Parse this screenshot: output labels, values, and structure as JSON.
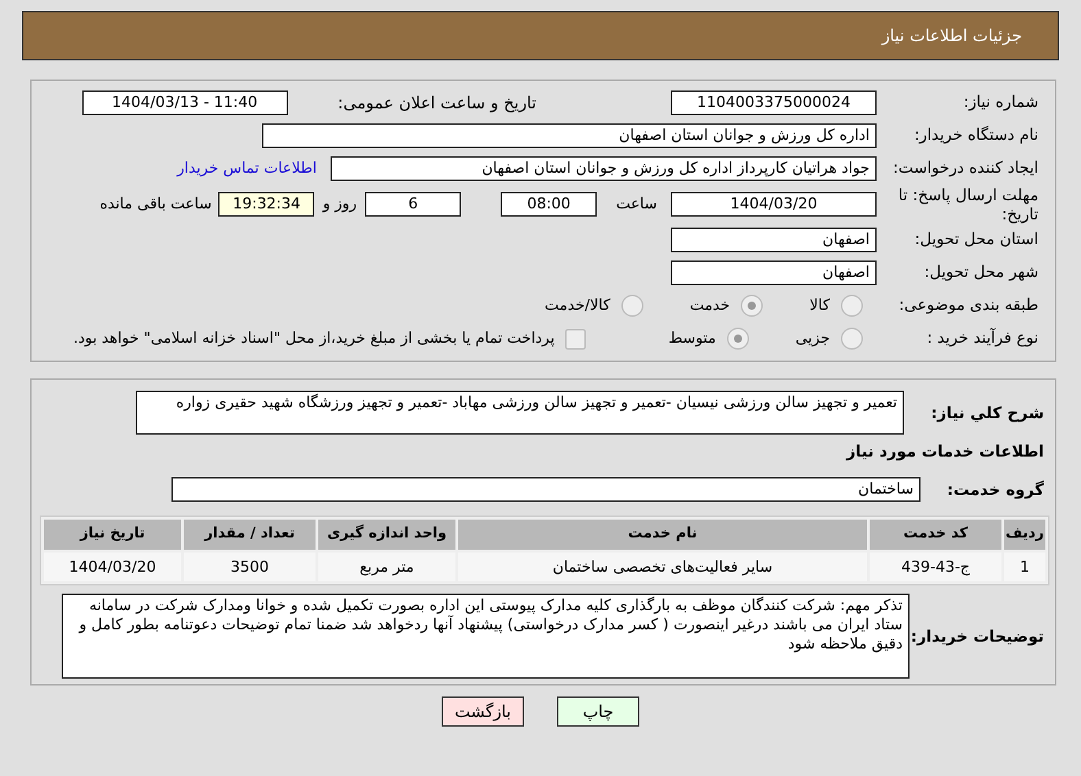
{
  "header": {
    "title": "جزئیات اطلاعات نیاز"
  },
  "details": {
    "need_number": {
      "label": "شماره نیاز:",
      "value": "1104003375000024"
    },
    "announce_datetime": {
      "label": "تاریخ و ساعت اعلان عمومی:",
      "value": "1404/03/13 - 11:40"
    },
    "buyer_org": {
      "label": "نام دستگاه خریدار:",
      "value": "اداره کل ورزش و جوانان استان اصفهان"
    },
    "requester": {
      "label": "ایجاد کننده درخواست:",
      "value": "جواد هراتیان کارپرداز اداره کل ورزش و جوانان استان اصفهان",
      "link": "اطلاعات تماس خریدار"
    },
    "deadline": {
      "label": "مهلت ارسال پاسخ: تا تاریخ:",
      "date": "1404/03/20",
      "time_label": "ساعت",
      "time": "08:00",
      "days": "6",
      "days_label": "روز و",
      "remaining": "19:32:34",
      "remaining_label": "ساعت باقی مانده"
    },
    "province": {
      "label": "استان محل تحویل:",
      "value": "اصفهان"
    },
    "city": {
      "label": "شهر محل تحویل:",
      "value": "اصفهان"
    },
    "category": {
      "label": "طبقه بندی موضوعی:",
      "options": [
        {
          "label": "کالا",
          "selected": false
        },
        {
          "label": "خدمت",
          "selected": true
        },
        {
          "label": "کالا/خدمت",
          "selected": false
        }
      ]
    },
    "process": {
      "label": "نوع فرآیند خرید :",
      "options": [
        {
          "label": "جزیی",
          "selected": false
        },
        {
          "label": "متوسط",
          "selected": true
        }
      ],
      "payment": {
        "label": "پرداخت تمام یا بخشی از مبلغ خرید،از محل \"اسناد خزانه اسلامی\" خواهد بود.",
        "checked": false
      }
    }
  },
  "summary": {
    "label": "شرح کلي نياز:",
    "value": "تعمیر و تجهیز سالن ورزشی نیسیان -تعمیر و تجهیز سالن ورزشی مهاباد -تعمیر و تجهیز ورزشگاه شهید حقیری زواره"
  },
  "services": {
    "title": "اطلاعات خدمات مورد نیاز",
    "group_label": "گروه خدمت:",
    "group": "ساختمان",
    "table": {
      "columns": [
        "ردیف",
        "کد خدمت",
        "نام خدمت",
        "واحد اندازه گیری",
        "تعداد / مقدار",
        "تاریخ نیاز"
      ],
      "rows": [
        [
          "1",
          "ج-43-439",
          "سایر فعالیت‌های تخصصی ساختمان",
          "متر مربع",
          "3500",
          "1404/03/20"
        ]
      ]
    }
  },
  "buyer_notes": {
    "label": "توضیحات خریدار:",
    "value": "تذکر مهم: شرکت کنندگان موظف به بارگذاری کلیه مدارک پیوستی این اداره بصورت تکمیل شده و خوانا ومدارک شرکت در سامانه ستاد ایران می باشند درغیر اینصورت ( کسر مدارک درخواستی) پیشنهاد آنها ردخواهد شد ضمنا تمام توضیحات دعوتنامه بطور کامل و دقیق ملاحظه شود"
  },
  "buttons": [
    {
      "label": "چاپ",
      "kind": "print"
    },
    {
      "label": "بازگشت",
      "kind": "back"
    }
  ]
}
